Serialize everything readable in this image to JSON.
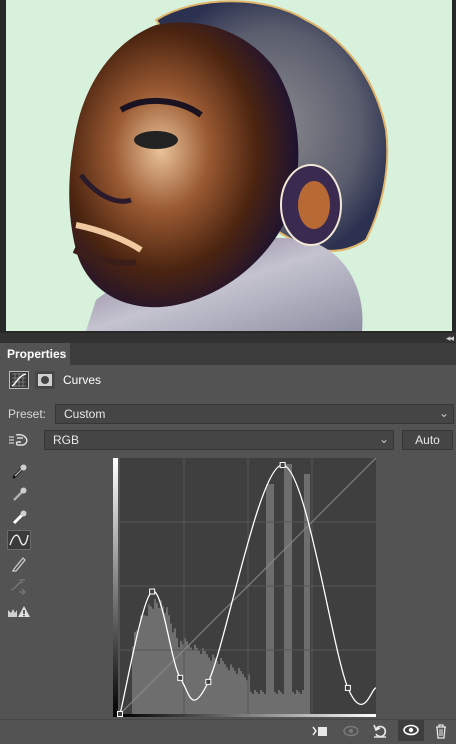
{
  "panel": {
    "tab_label": "Properties",
    "adjustment_title": "Curves"
  },
  "preset": {
    "label": "Preset:",
    "value": "Custom"
  },
  "channel": {
    "value": "RGB",
    "auto_label": "Auto"
  },
  "tools": [
    "target-adjust-hand-icon",
    "black-point-eyedropper-icon",
    "gray-point-eyedropper-icon",
    "white-point-eyedropper-icon",
    "curve-points-icon",
    "pencil-draw-icon",
    "smooth-curve-icon",
    "clipping-warning-icon"
  ],
  "curve_points": [
    {
      "input": 0,
      "output": 0
    },
    {
      "input": 32,
      "output": 122
    },
    {
      "input": 60,
      "output": 36
    },
    {
      "input": 88,
      "output": 32
    },
    {
      "input": 162,
      "output": 248
    },
    {
      "input": 227,
      "output": 26
    },
    {
      "input": 255,
      "output": 26
    }
  ],
  "bottom_icons": [
    "clip-to-layer-icon",
    "view-previous-state-icon",
    "reset-adjustments-icon",
    "visibility-eye-icon",
    "delete-icon"
  ]
}
